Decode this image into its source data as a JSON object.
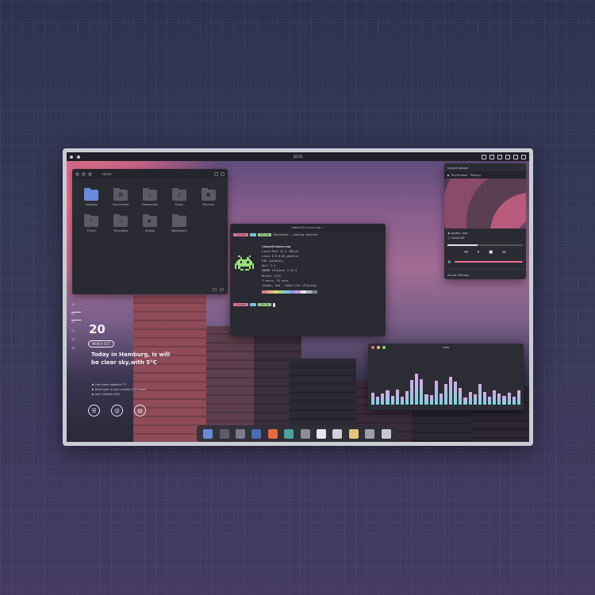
{
  "topbar": {
    "clock": "20:55"
  },
  "file_manager": {
    "path": "Home",
    "items": [
      {
        "label": "Desktop",
        "icon": "desktop-icon",
        "glyph": "",
        "active": true
      },
      {
        "label": "Documents",
        "icon": "document-icon",
        "glyph": "▤",
        "active": false
      },
      {
        "label": "Downloads",
        "icon": "download-icon",
        "glyph": "⤓",
        "active": false
      },
      {
        "label": "Music",
        "icon": "music-icon",
        "glyph": "♫",
        "active": false
      },
      {
        "label": "Pictures",
        "icon": "picture-icon",
        "glyph": "▣",
        "active": false
      },
      {
        "label": "Public",
        "icon": "share-icon",
        "glyph": "⇪",
        "active": false
      },
      {
        "label": "Templates",
        "icon": "template-icon",
        "glyph": "▭",
        "active": false
      },
      {
        "label": "Videos",
        "icon": "video-icon",
        "glyph": "▶",
        "active": false
      },
      {
        "label": "Wallpapers",
        "icon": "wallpaper-icon",
        "glyph": "",
        "active": false
      }
    ]
  },
  "terminal": {
    "title": "hamani@linuxscrap:~",
    "prompt_user": "linuxs",
    "prompt_dir": "~",
    "prompt_time": "20:54",
    "command": "fastfetch --config sysinfo",
    "header": "linuxs@linuxscrap",
    "info": [
      "Linux Mint 22.2 x86_64",
      "Linux 6.8.0-85-generic",
      "PID (Qstatus)",
      "Dell 3.4",
      "GNOME Terminal 3.52.0",
      "Mutter (X11)",
      "3 hours, 52 mins",
      "Jaydes, Ana - Good Life (Playing)"
    ],
    "palette": [
      "#e07a9a",
      "#e6a97d",
      "#e0d27a",
      "#9bd48c",
      "#7dc4e0",
      "#8c9be0",
      "#c69be0",
      "#e0e0ea",
      "#b0b4c0",
      "#7a8090"
    ]
  },
  "calendar": {
    "days": [
      "19",
      "20",
      "21",
      "22",
      "23",
      "24"
    ],
    "today_index": 1
  },
  "widget": {
    "date": "20",
    "day_pill": "MON 6 OCT",
    "weather": "Today in Hamburg, is will be clear sky,with 5°C",
    "tips": [
      "Feel warm appetite 7°C",
      "Brief sport in your comfort & 2.5 mph",
      "and humidity 44%"
    ]
  },
  "player": {
    "launcher_label": "Launch player",
    "tab_label": "Rhythmbox · Playing",
    "artist": "Jaydes, Ana",
    "track": "Good Life",
    "footer": "Sound Settings",
    "progress": 0.4,
    "colors": {
      "accent": "#e76a92"
    }
  },
  "visualizer": {
    "title": "cava",
    "levels": [
      0.3,
      0.2,
      0.28,
      0.36,
      0.22,
      0.38,
      0.2,
      0.34,
      0.62,
      0.78,
      0.64,
      0.26,
      0.24,
      0.6,
      0.28,
      0.52,
      0.7,
      0.58,
      0.42,
      0.18,
      0.32,
      0.26,
      0.52,
      0.32,
      0.2,
      0.36,
      0.28,
      0.22,
      0.3,
      0.2,
      0.36
    ]
  },
  "dock": {
    "apps": [
      {
        "name": "show-desktop",
        "color": "#6a8ad9"
      },
      {
        "name": "workspace",
        "color": "#5b5d6b"
      },
      {
        "name": "files",
        "color": "#7a7c8a"
      },
      {
        "name": "cleaner",
        "color": "#4a6eb0"
      },
      {
        "name": "firefox",
        "color": "#e46b3c"
      },
      {
        "name": "image-viewer",
        "color": "#4aa3a0"
      },
      {
        "name": "calculator",
        "color": "#8a8c98"
      },
      {
        "name": "calendar",
        "color": "#e6e6ee"
      },
      {
        "name": "clock",
        "color": "#d0d0d8"
      },
      {
        "name": "store",
        "color": "#e3c480"
      },
      {
        "name": "trash",
        "color": "#9aa0ac"
      },
      {
        "name": "settings",
        "color": "#c8c8d2"
      }
    ]
  }
}
